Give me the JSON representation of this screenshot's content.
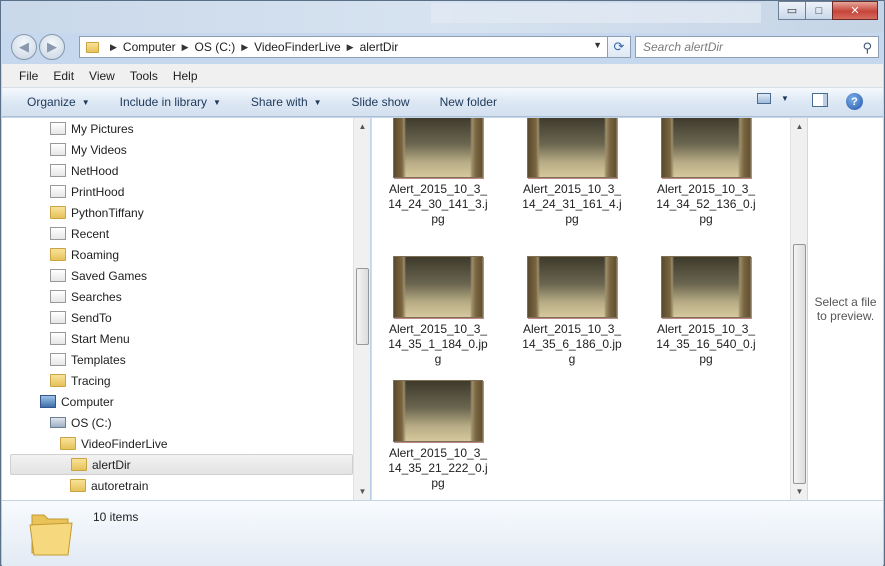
{
  "window": {
    "controls": {
      "minimize": "▭",
      "maximize": "□",
      "close": "✕"
    }
  },
  "address": {
    "crumbs": [
      "Computer",
      "OS (C:)",
      "VideoFinderLive",
      "alertDir"
    ],
    "search_placeholder": "Search alertDir"
  },
  "menu": [
    "File",
    "Edit",
    "View",
    "Tools",
    "Help"
  ],
  "commands": {
    "organize": "Organize",
    "include_in_library": "Include in library",
    "share_with": "Share with",
    "slide_show": "Slide show",
    "new_folder": "New folder"
  },
  "nav_tree": [
    {
      "label": "My Pictures",
      "icon": "special-folder-icon",
      "indent": 0
    },
    {
      "label": "My Videos",
      "icon": "special-folder-icon",
      "indent": 0
    },
    {
      "label": "NetHood",
      "icon": "shortcut-icon",
      "indent": 0
    },
    {
      "label": "PrintHood",
      "icon": "shortcut-icon",
      "indent": 0
    },
    {
      "label": "PythonTiffany",
      "icon": "folder-icon",
      "indent": 0
    },
    {
      "label": "Recent",
      "icon": "shortcut-icon",
      "indent": 0
    },
    {
      "label": "Roaming",
      "icon": "folder-icon",
      "indent": 0
    },
    {
      "label": "Saved Games",
      "icon": "saved-games-icon",
      "indent": 0
    },
    {
      "label": "Searches",
      "icon": "searches-icon",
      "indent": 0
    },
    {
      "label": "SendTo",
      "icon": "shortcut-icon",
      "indent": 0
    },
    {
      "label": "Start Menu",
      "icon": "shortcut-icon",
      "indent": 0
    },
    {
      "label": "Templates",
      "icon": "shortcut-icon",
      "indent": 0
    },
    {
      "label": "Tracing",
      "icon": "folder-icon",
      "indent": 0
    },
    {
      "label": "Computer",
      "icon": "computer-icon",
      "indent": -1
    },
    {
      "label": "OS (C:)",
      "icon": "drive-icon",
      "indent": 0
    },
    {
      "label": "VideoFinderLive",
      "icon": "folder-icon",
      "indent": 1
    },
    {
      "label": "alertDir",
      "icon": "folder-icon",
      "indent": 2,
      "selected": true
    },
    {
      "label": "autoretrain",
      "icon": "folder-icon",
      "indent": 2
    }
  ],
  "files": [
    "Alert_2015_10_3_14_24_30_141_3.jpg",
    "Alert_2015_10_3_14_24_31_161_4.jpg",
    "Alert_2015_10_3_14_34_52_136_0.jpg",
    "Alert_2015_10_3_14_35_1_184_0.jpg",
    "Alert_2015_10_3_14_35_6_186_0.jpg",
    "Alert_2015_10_3_14_35_16_540_0.jpg",
    "Alert_2015_10_3_14_35_21_222_0.jpg"
  ],
  "preview_text": "Select a file to preview.",
  "status": {
    "count": "10 items"
  }
}
